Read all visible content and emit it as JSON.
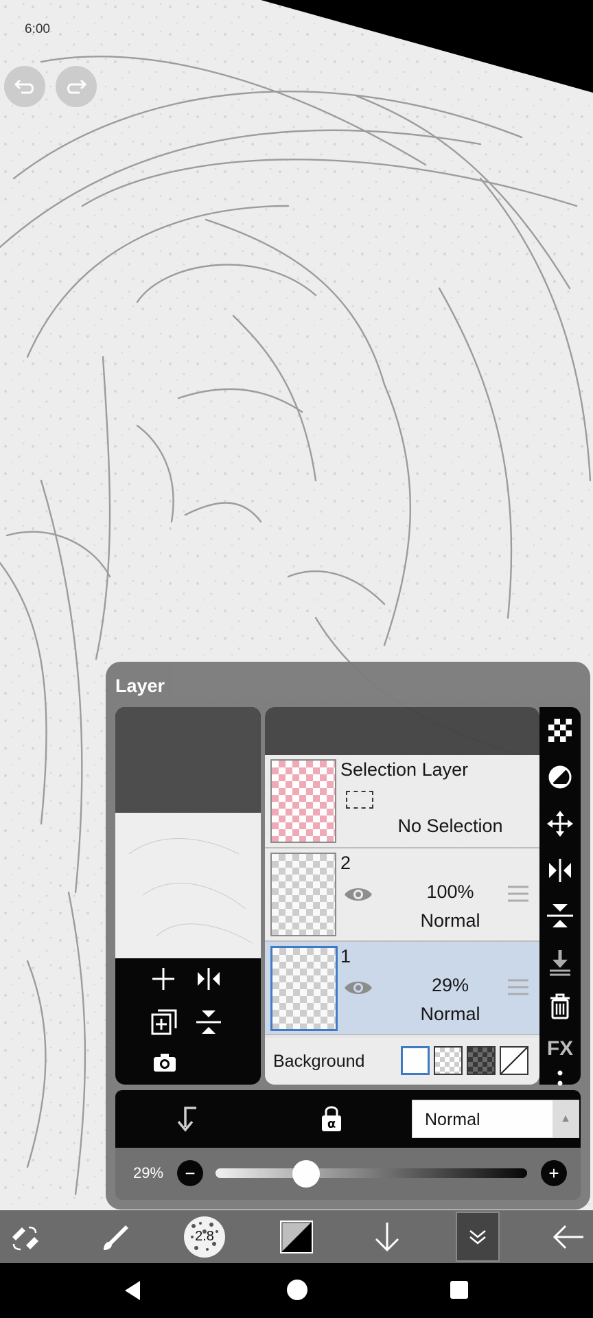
{
  "status_bar": {
    "time": "6:00"
  },
  "layer_panel": {
    "title": "Layer",
    "selection_layer": {
      "title": "Selection Layer",
      "status": "No Selection"
    },
    "layers": [
      {
        "number": "2",
        "opacity": "100%",
        "blend": "Normal",
        "selected": false
      },
      {
        "number": "1",
        "opacity": "29%",
        "blend": "Normal",
        "selected": true
      }
    ],
    "background_label": "Background",
    "blend_mode": "Normal",
    "opacity_label": "29%",
    "opacity_value": 0.29
  },
  "side_icons": [
    "checker-icon",
    "circle-half-icon",
    "move-icon",
    "flip-horizontal-icon",
    "flip-vertical-icon",
    "merge-down-icon",
    "trash-icon",
    "fx-icon",
    "more-icon"
  ],
  "side_fx_label": "FX",
  "toolbar": {
    "brush_size": "2.8"
  }
}
